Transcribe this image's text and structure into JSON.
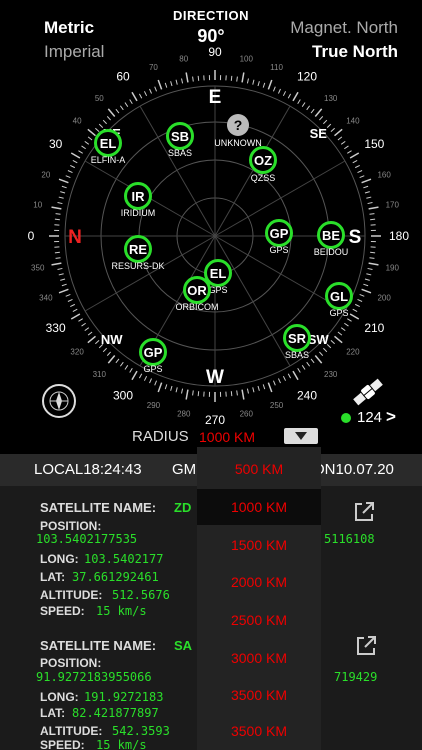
{
  "header": {
    "unit_metric": "Metric",
    "unit_imperial": "Imperial",
    "north_magnetic": "Magnet. North",
    "north_true": "True North",
    "direction_label": "DIRECTION",
    "direction_value": "90°"
  },
  "compass": {
    "cardinals": [
      "N",
      "E",
      "S",
      "W"
    ],
    "ring_labels": [
      "0",
      "10",
      "20",
      "30",
      "40",
      "50",
      "60",
      "70",
      "80",
      "90",
      "100",
      "110",
      "120",
      "130",
      "140",
      "150",
      "160",
      "170",
      "180",
      "190",
      "200",
      "210",
      "220",
      "230",
      "240",
      "250",
      "260",
      "270",
      "280",
      "290",
      "300",
      "310",
      "320",
      "330",
      "340",
      "350"
    ],
    "intercardinals": [
      "NE",
      "SE",
      "SW",
      "NW"
    ]
  },
  "satellites": [
    {
      "code": "EL",
      "name": "ELFIN-A"
    },
    {
      "code": "SB",
      "name": "SBAS"
    },
    {
      "code": "?",
      "name": "UNKNOWN"
    },
    {
      "code": "OZ",
      "name": "QZSS"
    },
    {
      "code": "IR",
      "name": "IRIDIUM"
    },
    {
      "code": "GP",
      "name": "GPS"
    },
    {
      "code": "BE",
      "name": "BEIDOU"
    },
    {
      "code": "RE",
      "name": "RESURS-DK"
    },
    {
      "code": "EL",
      "name": "GPS"
    },
    {
      "code": "OR",
      "name": "ORBICOM"
    },
    {
      "code": "GL",
      "name": "GPS"
    },
    {
      "code": "SR",
      "name": "SBAS"
    },
    {
      "code": "GP",
      "name": "GPS"
    }
  ],
  "status": {
    "count": "124",
    "chevron": ">"
  },
  "radius": {
    "label": "RADIUS",
    "value": "1000 KM"
  },
  "time": {
    "local": "LOCAL18:24:43",
    "gmt": "GM",
    "date": "ON10.07.20"
  },
  "cards": [
    {
      "name_label": "SATELLITE NAME:",
      "name_value": "ZD",
      "position_label": "POSITION:",
      "position_value": "103.5402177535",
      "position_tail": "5116108",
      "long_label": "LONG:",
      "long_value": "103.5402177",
      "lat_label": "LAT:",
      "lat_value": "37.661292461",
      "alt_label": "ALTITUDE:",
      "alt_value": "512.5676",
      "speed_label": "SPEED:",
      "speed_value": "15 km/s"
    },
    {
      "name_label": "SATELLITE NAME:",
      "name_value": "SA",
      "position_label": "POSITION:",
      "position_value": "91.9272183955066",
      "position_tail": "719429",
      "long_label": "LONG:",
      "long_value": "191.9272183",
      "lat_label": "LAT:",
      "lat_value": "82.421877897",
      "alt_label": "ALTITUDE:",
      "alt_value": "542.3593",
      "speed_label": "SPEED:",
      "speed_value": "15 km/s"
    }
  ],
  "radius_options": [
    "500 KM",
    "1000 KM",
    "1500 KM",
    "2000 KM",
    "2500 KM",
    "3000 KM",
    "3500 KM",
    "3500 KM"
  ],
  "colors": {
    "satellite_ring": "#2adf2a",
    "radius_text": "#ee0000",
    "north_marker": "#ee2222"
  }
}
